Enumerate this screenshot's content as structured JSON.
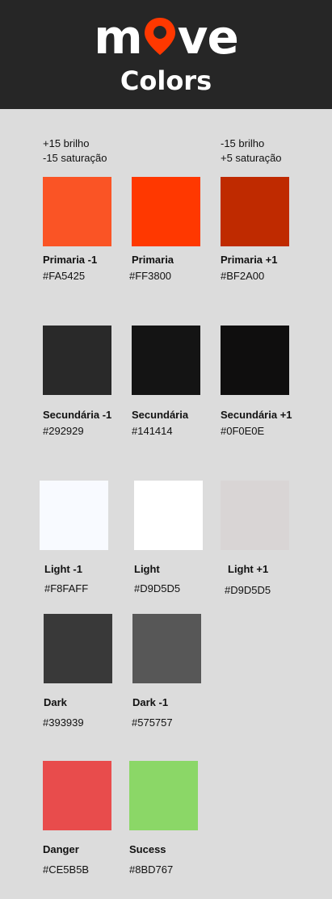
{
  "header": {
    "logo_left": "m",
    "logo_right": "ve",
    "title": "Colors",
    "logo_pin_color": "#FF3800",
    "background": "#262626"
  },
  "notes": {
    "left_line1": "+15 brilho",
    "left_line2": "-15 saturação",
    "right_line1": "-15 brilho",
    "right_line2": "+5 saturação"
  },
  "swatches": [
    {
      "name": "Primaria -1",
      "hex": "#FA5425",
      "color": "#FA5425"
    },
    {
      "name": "Primaria",
      "hex": "#FF3800",
      "color": "#FF3800"
    },
    {
      "name": "Primaria +1",
      "hex": "#BF2A00",
      "color": "#BF2A00"
    },
    {
      "name": "Secundária -1",
      "hex": "#292929",
      "color": "#292929"
    },
    {
      "name": "Secundária",
      "hex": "#141414",
      "color": "#141414"
    },
    {
      "name": "Secundária +1",
      "hex": "#0F0E0E",
      "color": "#0F0E0E"
    },
    {
      "name": "Light -1",
      "hex": "#F8FAFF",
      "color": "#F8FAFF"
    },
    {
      "name": "Light",
      "hex": "#D9D5D5",
      "color": "#FFFFFF"
    },
    {
      "name": "Light +1",
      "hex": "#D9D5D5",
      "color": "#D9D5D5"
    },
    {
      "name": "Dark",
      "hex": "#393939",
      "color": "#393939"
    },
    {
      "name": "Dark -1",
      "hex": "#575757",
      "color": "#575757"
    },
    {
      "name": "Danger",
      "hex": "#CE5B5B",
      "color": "#E84C4C"
    },
    {
      "name": "Sucess",
      "hex": "#8BD767",
      "color": "#8BD767"
    }
  ]
}
